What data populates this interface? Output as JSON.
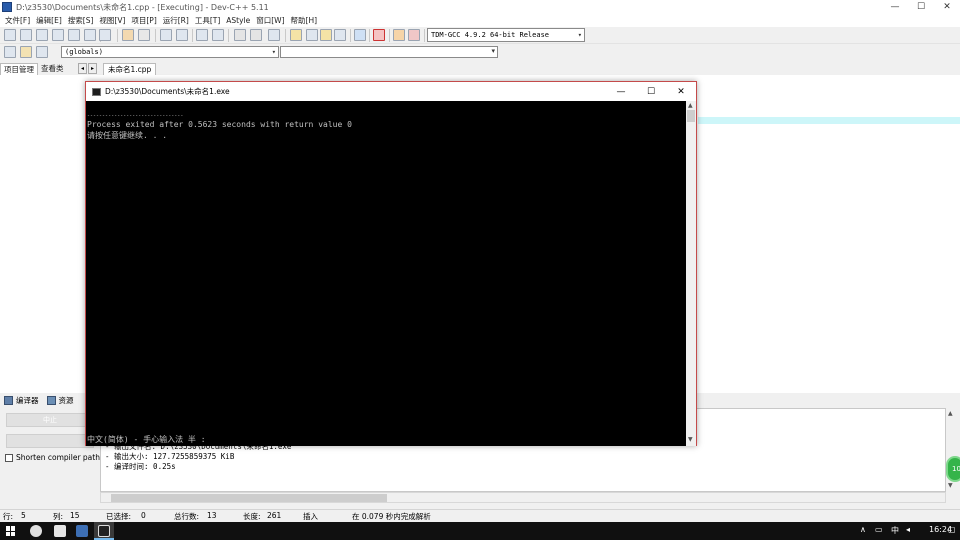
{
  "window": {
    "title": "D:\\z3530\\Documents\\未命名1.cpp - [Executing] - Dev-C++ 5.11",
    "min": "—",
    "max": "☐",
    "close": "✕"
  },
  "menu": [
    "文件[F]",
    "编辑[E]",
    "搜索[S]",
    "视图[V]",
    "项目[P]",
    "运行[R]",
    "工具[T]",
    "AStyle",
    "窗口[W]",
    "帮助[H]"
  ],
  "toolbar": {
    "compiler": "TDM-GCC 4.9.2 64-bit Release",
    "scope": "(globals)"
  },
  "left_tabs": [
    "项目管理",
    "查看类"
  ],
  "editor": {
    "nav_prev": "◂",
    "nav_next": "▸",
    "file_tab": "未命名1.cpp"
  },
  "bottom_tabs": [
    "编译器",
    "资源"
  ],
  "bottom": {
    "btn1": "中止",
    "shorten_label": "Shorten compiler paths",
    "log": [
      "- 输出文件名: D:\\z3530\\Documents\\未命名1.exe",
      "- 输出大小: 127.7255859375 KiB",
      "- 编译时间: 0.25s"
    ],
    "badge": "10"
  },
  "status": {
    "row_label": "行:",
    "row": "5",
    "col_label": "列:",
    "col": "15",
    "sel_label": "已选择:",
    "sel": "0",
    "total_label": "总行数:",
    "total": "13",
    "len_label": "长度:",
    "len": "261",
    "mode": "插入",
    "parse": "在 0.079 秒内完成解析"
  },
  "taskbar": {
    "tray_caret": "∧",
    "ime": "中",
    "time": "16:24"
  },
  "console": {
    "title": "D:\\z3530\\Documents\\未命名1.exe",
    "min": "—",
    "max": "☐",
    "close": "✕",
    "lines": [
      "--------------------------------",
      "Process exited after 0.5623 seconds with return value 0",
      "请按任意键继续. . ."
    ],
    "ime_status": "中文(简体) - 手心输入法 半 :"
  }
}
